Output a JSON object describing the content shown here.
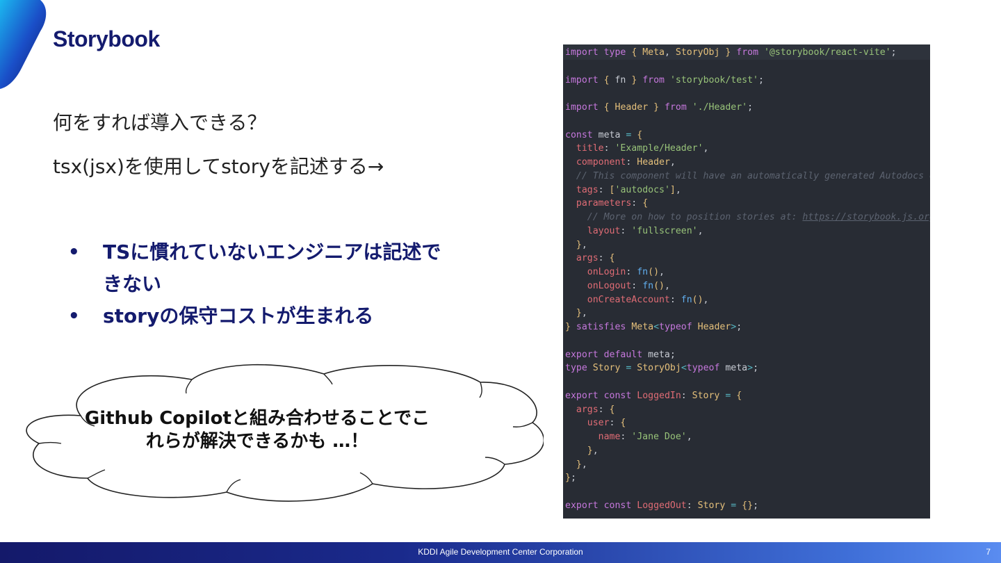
{
  "slide": {
    "title": "Storybook",
    "question": "何をすれば導入できる？",
    "description": "tsx(jsx)を使用してstoryを記述する→",
    "bullets": [
      "TSに慣れていないエンジニアは記述できない",
      "storyの保守コストが生まれる"
    ],
    "cloud_text": "Github Copilotと組み合わせることでこれらが解決できるかも …！"
  },
  "code_lines": [
    "import type { Meta, StoryObj } from '@storybook/react-vite';",
    "",
    "import { fn } from 'storybook/test';",
    "",
    "import { Header } from './Header';",
    "",
    "const meta = {",
    "  title: 'Example/Header',",
    "  component: Header,",
    "  // This component will have an automatically generated Autodocs e",
    "  tags: ['autodocs'],",
    "  parameters: {",
    "    // More on how to position stories at: https://storybook.js.org",
    "    layout: 'fullscreen',",
    "  },",
    "  args: {",
    "    onLogin: fn(),",
    "    onLogout: fn(),",
    "    onCreateAccount: fn(),",
    "  },",
    "} satisfies Meta<typeof Header>;",
    "",
    "export default meta;",
    "type Story = StoryObj<typeof meta>;",
    "",
    "export const LoggedIn: Story = {",
    "  args: {",
    "    user: {",
    "      name: 'Jane Doe',",
    "    },",
    "  },",
    "};",
    "",
    "export const LoggedOut: Story = {};"
  ],
  "footer": {
    "company": "KDDI Agile Development Center Corporation",
    "page_number": "7"
  },
  "colors": {
    "title": "#141b6e",
    "code_background": "#282c34",
    "footer_start": "#14196a",
    "footer_end": "#5a8cf0"
  }
}
